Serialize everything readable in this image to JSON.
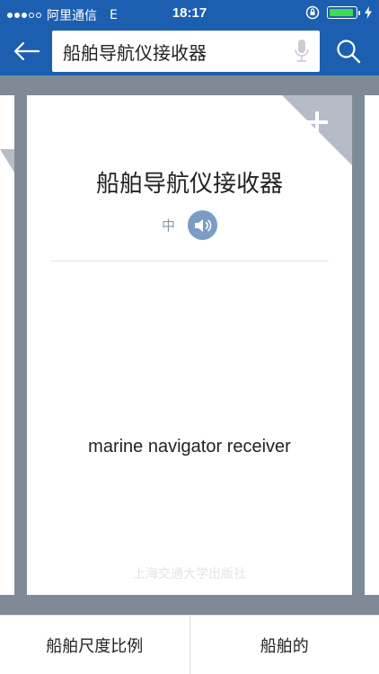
{
  "status_bar": {
    "carrier": "阿里通信",
    "network": "E",
    "time": "18:17",
    "signal_bars_filled": 3,
    "signal_bars_total": 5
  },
  "search": {
    "query": "船舶导航仪接收器"
  },
  "card": {
    "term": "船舶导航仪接收器",
    "language": "中",
    "translation": "marine navigator receiver",
    "publisher": "上海交通大学出版社"
  },
  "related": [
    {
      "label": "船舶尺度比例"
    },
    {
      "label": "船舶的"
    }
  ],
  "colors": {
    "header": "#1c5fb0",
    "background": "#7f8a97",
    "speaker": "#7a9cc5",
    "corner": "#b5bcc6"
  },
  "icons": [
    "back-arrow-icon",
    "mic-icon",
    "search-icon",
    "plus-icon",
    "speaker-icon",
    "battery-icon",
    "lock-rotation-icon"
  ]
}
